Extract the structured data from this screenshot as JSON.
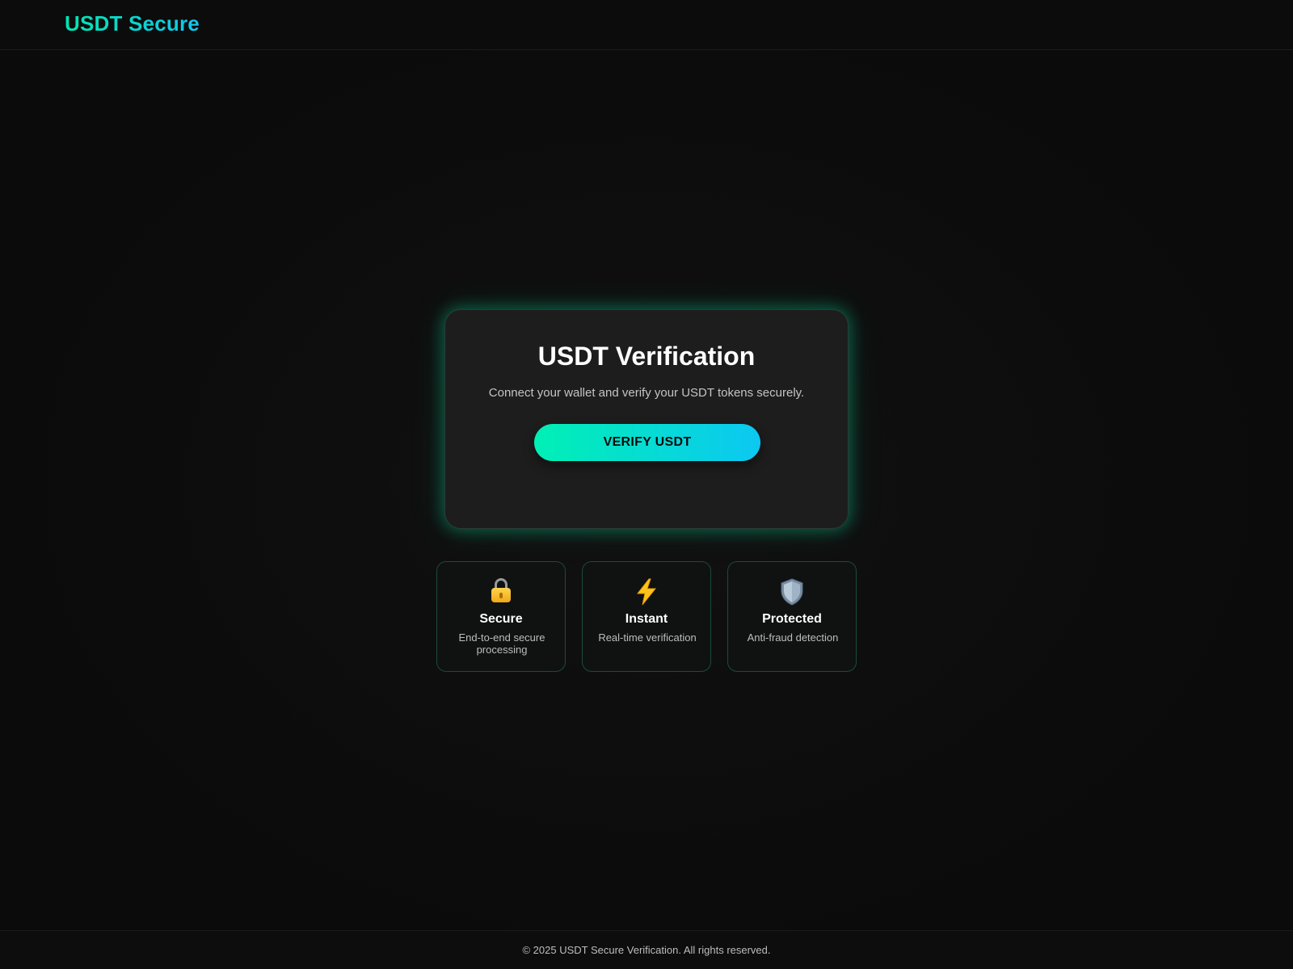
{
  "header": {
    "logo": "USDT Secure"
  },
  "main": {
    "title": "USDT Verification",
    "description": "Connect your wallet and verify your USDT tokens securely.",
    "verify_button": "VERIFY USDT"
  },
  "features": [
    {
      "icon": "lock-icon",
      "title": "Secure",
      "description": "End-to-end secure processing"
    },
    {
      "icon": "lightning-icon",
      "title": "Instant",
      "description": "Real-time verification"
    },
    {
      "icon": "shield-icon",
      "title": "Protected",
      "description": "Anti-fraud detection"
    }
  ],
  "footer": {
    "text": "© 2025 USDT Secure Verification. All rights reserved."
  },
  "colors": {
    "accent_start": "#00f0b4",
    "accent_end": "#0cc8f2",
    "background": "#0b0b0b",
    "card": "#1d1d1d"
  }
}
